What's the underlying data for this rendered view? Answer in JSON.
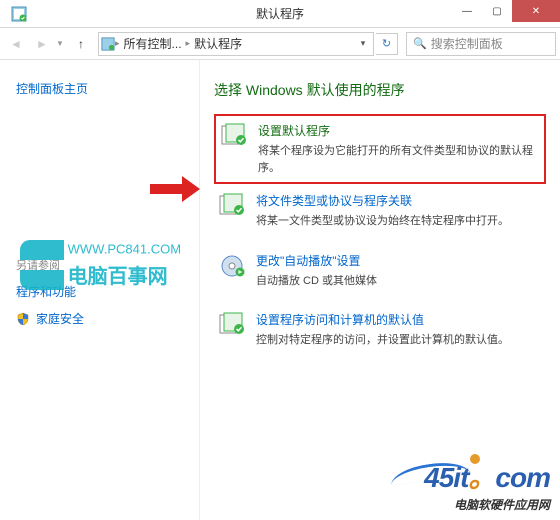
{
  "titlebar": {
    "title": "默认程序"
  },
  "win_controls": {
    "min": "—",
    "max": "▢",
    "close": "✕"
  },
  "nav": {
    "crumb1": "所有控制...",
    "crumb2": "默认程序",
    "search_placeholder": "搜索控制面板"
  },
  "sidebar": {
    "home": "控制面板主页",
    "also": "另请参阅",
    "link1": "程序和功能",
    "link2": "家庭安全"
  },
  "heading": "选择 Windows 默认使用的程序",
  "options": [
    {
      "title": "设置默认程序",
      "desc": "将某个程序设为它能打开的所有文件类型和协议的默认程序。"
    },
    {
      "title": "将文件类型或协议与程序关联",
      "desc": "将某一文件类型或协议设为始终在特定程序中打开。"
    },
    {
      "title": "更改\"自动播放\"设置",
      "desc": "自动播放 CD 或其他媒体"
    },
    {
      "title": "设置程序访问和计算机的默认值",
      "desc": "控制对特定程序的访问，并设置此计算机的默认值。"
    }
  ],
  "watermarks": {
    "a_url": "WWW.PC841.COM",
    "a_name": "电脑百事网",
    "b_num": "45it",
    "b_dot": "。",
    "b_sub": "电脑软硬件应用网"
  }
}
